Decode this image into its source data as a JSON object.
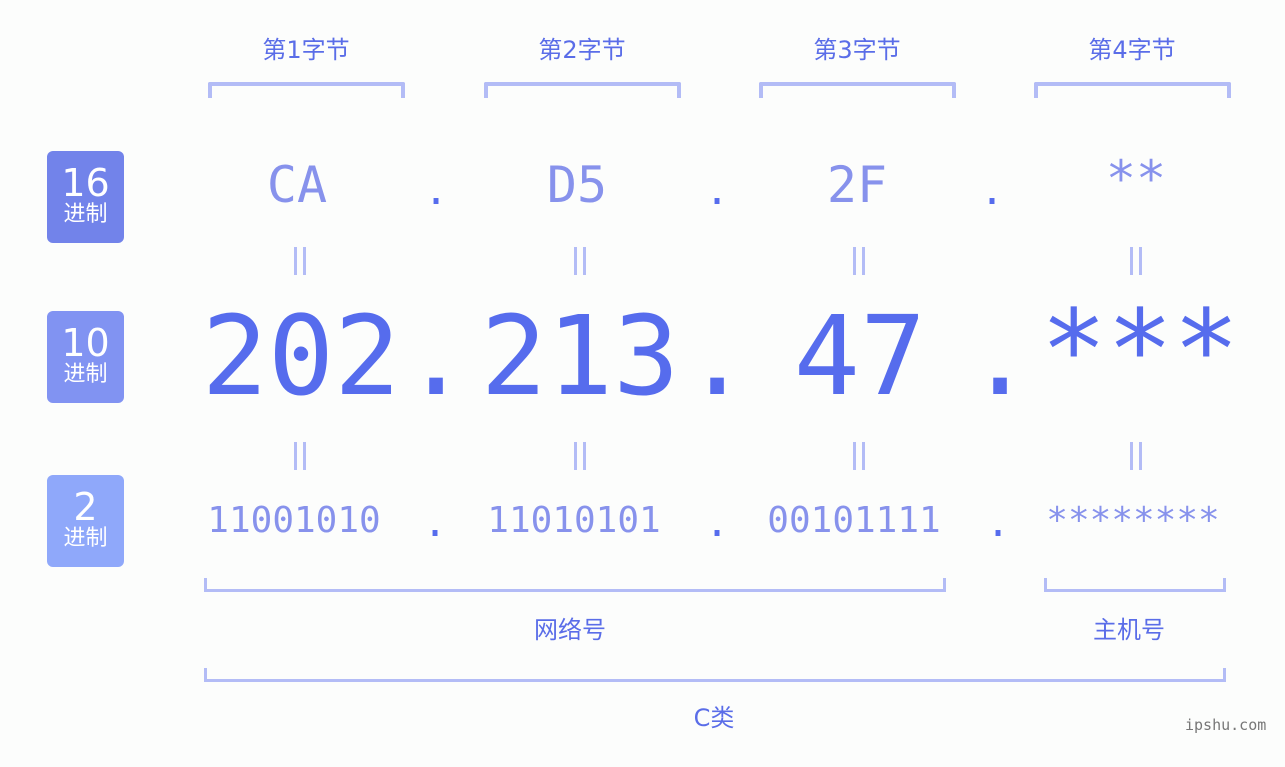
{
  "byte_headers": [
    "第1字节",
    "第2字节",
    "第3字节",
    "第4字节"
  ],
  "badges": [
    {
      "num": "16",
      "unit": "进制",
      "color": "#7283ea"
    },
    {
      "num": "10",
      "unit": "进制",
      "color": "#8193f2"
    },
    {
      "num": "2",
      "unit": "进制",
      "color": "#8fa8fa"
    }
  ],
  "hex": [
    "CA",
    "D5",
    "2F",
    "**"
  ],
  "decimal": [
    "202",
    "213",
    "47",
    "***"
  ],
  "binary": [
    "11001010",
    "11010101",
    "00101111",
    "********"
  ],
  "separator": ".",
  "equals": "=",
  "labels": {
    "network": "网络号",
    "host": "主机号",
    "class": "C类"
  },
  "watermark": "ipshu.com",
  "colors": {
    "accent": "#566ced",
    "light": "#8792ec",
    "bracket": "#b3bcf6",
    "background": "#fcfdfc"
  }
}
